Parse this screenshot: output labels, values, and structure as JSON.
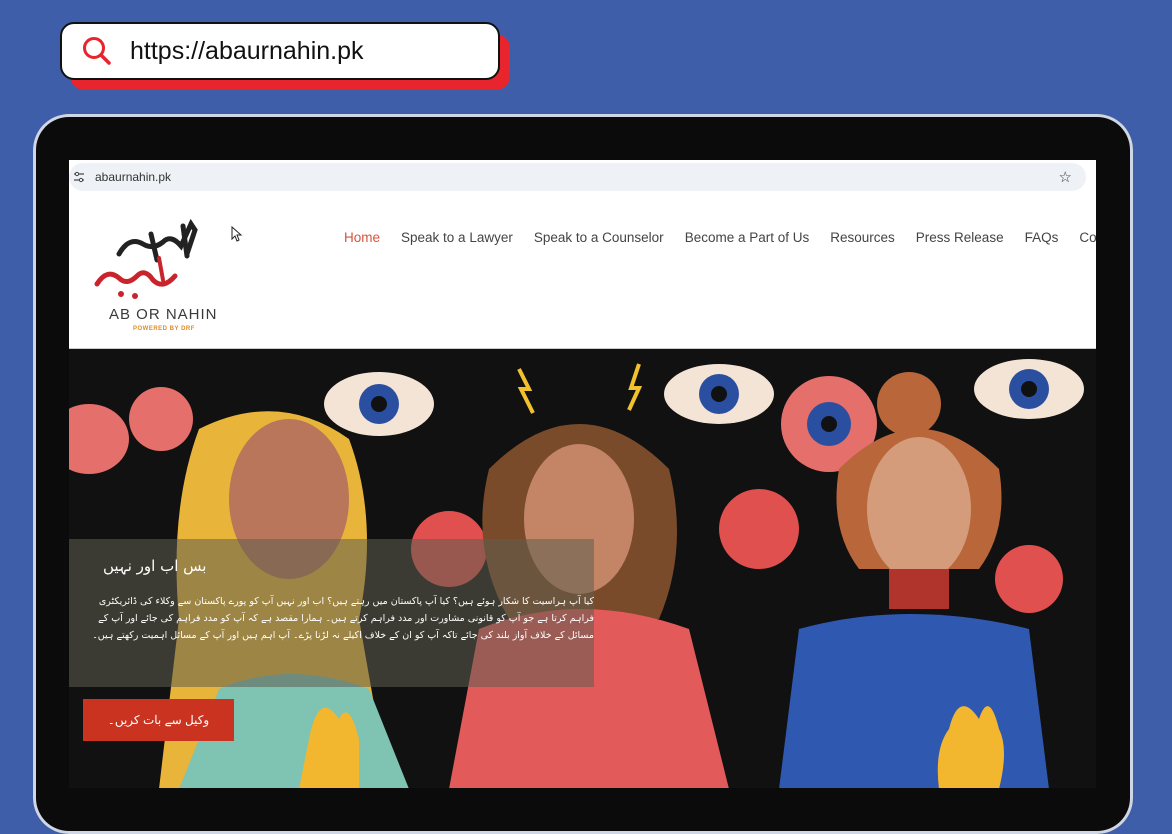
{
  "search": {
    "url": "https://abaurnahin.pk",
    "icon": "search-icon",
    "accent": "#e8242c"
  },
  "browser": {
    "address": "abaurnahin.pk",
    "star_icon": "star-icon"
  },
  "site": {
    "logo": {
      "urdu": "اب اور نہیں",
      "name": "AB OR NAHIN",
      "powered": "POWERED BY DRF"
    },
    "nav": [
      {
        "label": "Home",
        "active": true
      },
      {
        "label": "Speak to a Lawyer"
      },
      {
        "label": "Speak to a Counselor"
      },
      {
        "label": "Become a Part of Us"
      },
      {
        "label": "Resources"
      },
      {
        "label": "Press Release"
      },
      {
        "label": "FAQs"
      },
      {
        "label": "Contact"
      }
    ],
    "nav_active_color": "#d9533c"
  },
  "hero": {
    "title": "بس اب اور نہیں",
    "body": "کیا آپ ہراسیت کا شکار ہوئے ہیں؟ کیا آپ پاکستان میں رہتے ہیں؟ اب اور نہیں آپ کو پورے پاکستان سے وکلاء کی ڈائریکٹری فراہم کرتا ہے جو آپ کو قانونی مشاورت اور مدد فراہم کرتے ہیں۔ ہمارا مقصد ہے کہ آپ کو مدد فراہم کی جائے اور آپ کے مسائل کے خلاف آواز بلند کی جائے تاکہ آپ کو ان کے خلاف اکیلے نہ لڑنا پڑے۔ آپ اہم ہیں اور آپ کے مسائل اہمیت رکھتے ہیں۔",
    "cta": "وکیل سے بات کریں۔",
    "cta_color": "#c9331f"
  }
}
